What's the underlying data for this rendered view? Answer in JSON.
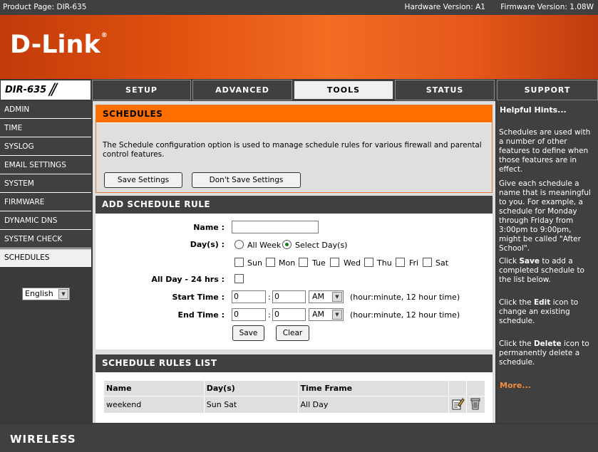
{
  "topbar": {
    "product": "Product Page: DIR-635",
    "hardware": "Hardware Version: A1",
    "firmware": "Firmware Version: 1.08W"
  },
  "brand": {
    "logo_text": "D-Link",
    "reg": "®",
    "model": "DIR-635",
    "footer_text": "WIRELESS"
  },
  "tabs": [
    "SETUP",
    "ADVANCED",
    "TOOLS",
    "STATUS",
    "SUPPORT"
  ],
  "sidebar": {
    "items": [
      "ADMIN",
      "TIME",
      "SYSLOG",
      "EMAIL SETTINGS",
      "SYSTEM",
      "FIRMWARE",
      "DYNAMIC DNS",
      "SYSTEM CHECK",
      "SCHEDULES"
    ],
    "language": "English"
  },
  "schedules": {
    "title": "SCHEDULES",
    "description": "The Schedule configuration option is used to manage schedule rules for various firewall and parental control features.",
    "save_label": "Save Settings",
    "dont_save_label": "Don't Save Settings"
  },
  "add_rule": {
    "title": "ADD SCHEDULE RULE",
    "name_label": "Name :",
    "name_value": "",
    "days_label": "Day(s) :",
    "all_week": "All Week",
    "select_days": "Select Day(s)",
    "days": [
      "Sun",
      "Mon",
      "Tue",
      "Wed",
      "Thu",
      "Fri",
      "Sat"
    ],
    "allday_label": "All Day - 24 hrs :",
    "start_label": "Start Time :",
    "end_label": "End Time :",
    "start_hour": "0",
    "start_min": "0",
    "start_ampm": "AM",
    "end_hour": "0",
    "end_min": "0",
    "end_ampm": "AM",
    "colon": ":",
    "time_hint": "(hour:minute, 12 hour time)",
    "save": "Save",
    "clear": "Clear"
  },
  "rules_list": {
    "title": "SCHEDULE RULES LIST",
    "headers": [
      "Name",
      "Day(s)",
      "Time Frame"
    ],
    "rows": [
      {
        "name": "weekend",
        "days": "Sun Sat",
        "time": "All Day"
      }
    ]
  },
  "hints": {
    "title": "Helpful Hints...",
    "p1": "Schedules are used with a number of other features to define when those features are in effect.",
    "p2": "Give each schedule a name that is meaningful to you. For example, a schedule for Monday through Friday from 3:00pm to 9:00pm, might be called \"After School\".",
    "p3_a": "Click ",
    "p3_b": "Save",
    "p3_c": " to add a completed schedule to the list below.",
    "p4_a": "Click the ",
    "p4_b": "Edit",
    "p4_c": " icon to change an existing schedule.",
    "p5_a": "Click the ",
    "p5_b": "Delete",
    "p5_c": " icon to permanently delete a schedule.",
    "more": "More..."
  },
  "colors": {
    "orange": "#ff6f00",
    "dark": "#404040",
    "panel": "#dfdfdf"
  }
}
